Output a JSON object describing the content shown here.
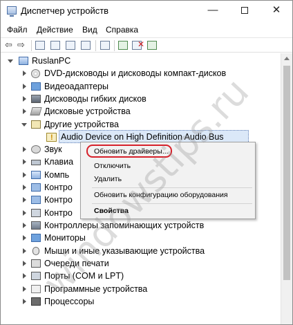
{
  "window": {
    "title": "Диспетчер устройств",
    "controls": {
      "minimize": "—",
      "close": "✕"
    }
  },
  "menu": [
    "Файл",
    "Действие",
    "Вид",
    "Справка"
  ],
  "tree": {
    "root": "RuslanPC",
    "items": [
      "DVD-дисководы и дисководы компакт-дисков",
      "Видеоадаптеры",
      "Дисководы гибких дисков",
      "Дисковые устройства",
      "Другие устройства",
      "Audio Device on High Definition Audio Bus",
      "Звук",
      "Клавиа",
      "Компь",
      "Контро",
      "Контро",
      "Контро",
      "Контроллеры запоминающих устройств",
      "Мониторы",
      "Мыши и иные указывающие устройства",
      "Очереди печати",
      "Порты (COM и LPT)",
      "Программные устройства",
      "Процессоры"
    ]
  },
  "context_menu": {
    "items": [
      "Обновить драйверы...",
      "Отключить",
      "Удалить",
      "Обновить конфигурацию оборудования",
      "Свойства"
    ]
  },
  "watermark": "windowstips.ru"
}
